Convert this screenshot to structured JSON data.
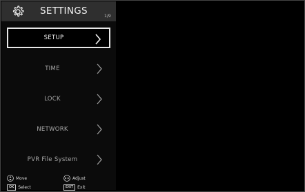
{
  "header": {
    "title": "SETTINGS",
    "page_counter": "1/9",
    "icon": "gear-icon"
  },
  "menu": {
    "selected_index": 0,
    "items": [
      {
        "label": "SETUP",
        "icon": "chevron-right-icon"
      },
      {
        "label": "TIME",
        "icon": "chevron-right-icon"
      },
      {
        "label": "LOCK",
        "icon": "chevron-right-icon"
      },
      {
        "label": "NETWORK",
        "icon": "chevron-right-icon"
      },
      {
        "label": "PVR File System",
        "icon": "chevron-right-icon"
      }
    ]
  },
  "footer": {
    "move": {
      "label": "Move",
      "icon": "up-down-keys-icon"
    },
    "adjust": {
      "label": "Adjust",
      "icon": "left-right-keys-icon"
    },
    "select": {
      "key": "OK",
      "label": "Select"
    },
    "exit": {
      "key": "EXIT",
      "label": "Exit"
    }
  },
  "colors": {
    "header_bg": "#2f2f2f",
    "panel_bg": "#0b0b0b",
    "selected_border": "#e8e8e8",
    "text_dim": "#a8a8a8"
  }
}
